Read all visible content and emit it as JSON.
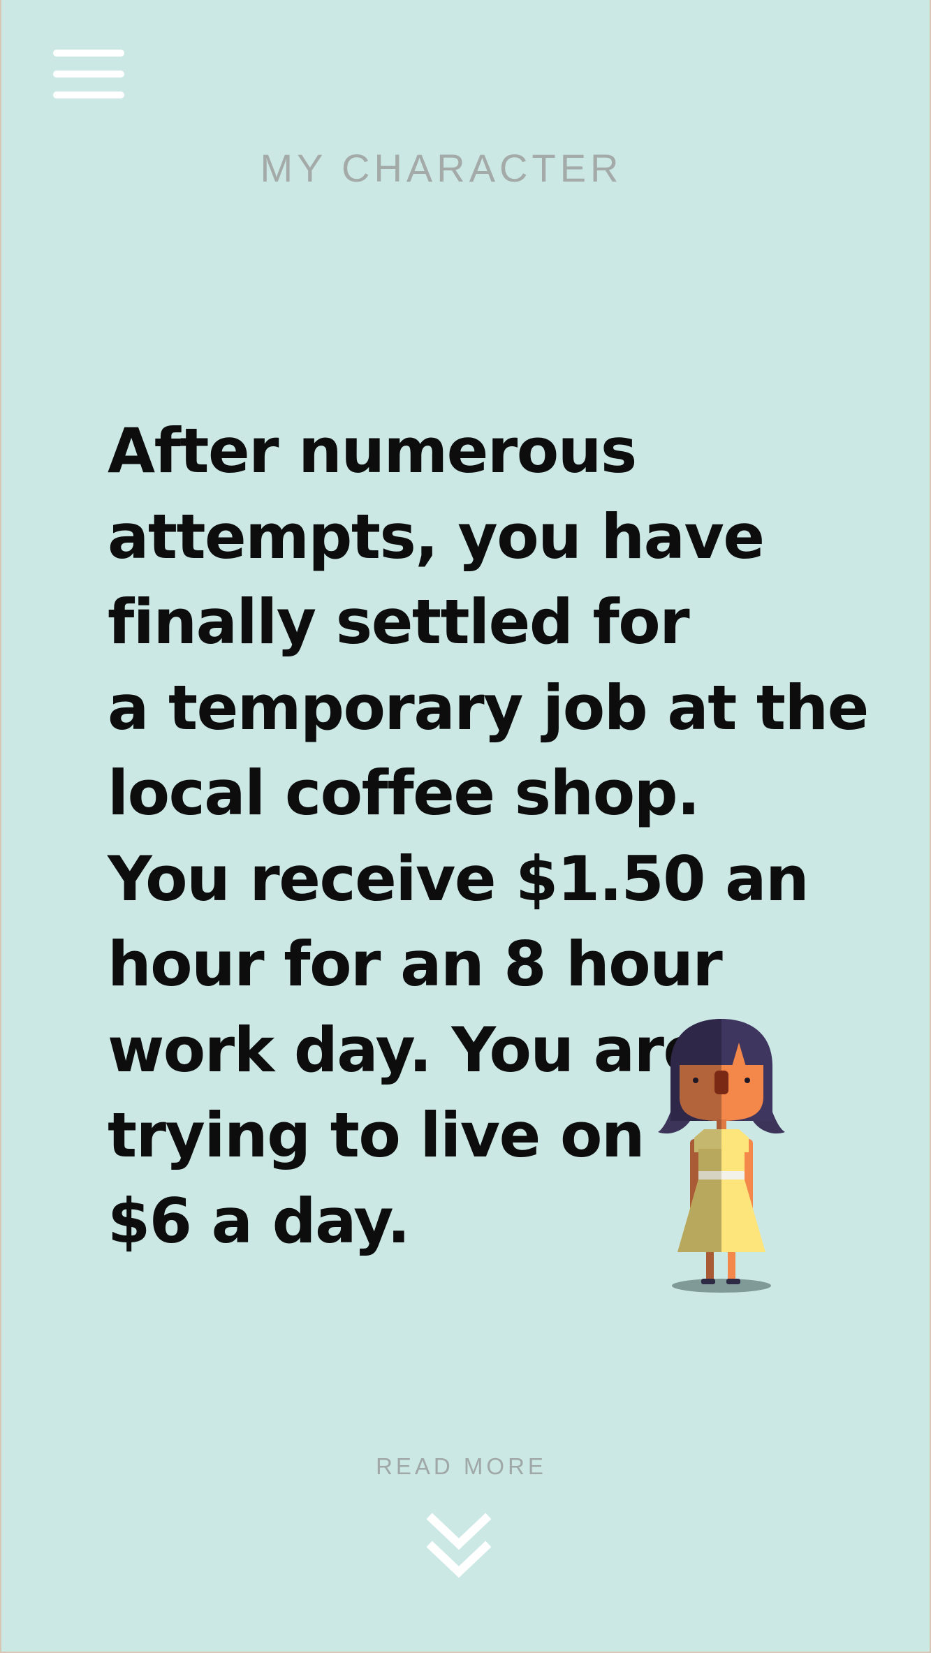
{
  "header": {
    "menu_icon": "hamburger-menu-icon",
    "title": "MY CHARACTER"
  },
  "story": {
    "lines": [
      "After numerous",
      "attempts, you have",
      "finally settled for",
      "a temporary job at the",
      "local coffee shop.",
      "You receive $1.50 an",
      "hour for an 8 hour",
      "work day. You are",
      "trying to live on",
      "$6 a day."
    ]
  },
  "character": {
    "icon": "girl-character-illustration"
  },
  "footer": {
    "read_more_label": "READ MORE",
    "chevron_icon": "double-chevron-down-icon"
  },
  "colors": {
    "background": "#cbe8e5",
    "title_text": "#a3aaa8",
    "story_text": "#0d0d0d",
    "icon_white": "#ffffff",
    "hair": "#3f3660",
    "skin": "#f4874a",
    "dress": "#fde57c"
  }
}
